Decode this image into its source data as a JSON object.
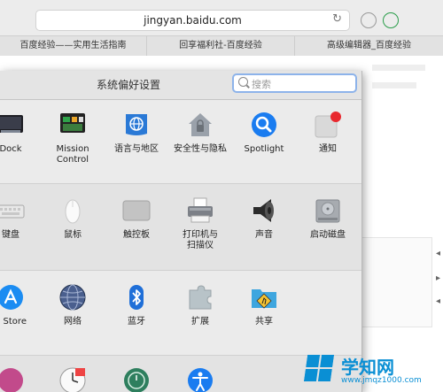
{
  "browser": {
    "url": "jingyan.baidu.com",
    "reload_icon": "reload-icon",
    "tabs": [
      "百度经验——实用生活指南",
      "回享福利社-百度经验",
      "高级编辑器_百度经验"
    ]
  },
  "window": {
    "title": "系统偏好设置",
    "search_placeholder": "搜索"
  },
  "rows": [
    [
      {
        "label": "Dock",
        "icon": "dock-icon"
      },
      {
        "label": "Mission\nControl",
        "icon": "mission-control-icon"
      },
      {
        "label": "语言与地区",
        "icon": "language-region-icon"
      },
      {
        "label": "安全性与隐私",
        "icon": "security-privacy-icon"
      },
      {
        "label": "Spotlight",
        "icon": "spotlight-icon"
      },
      {
        "label": "通知",
        "icon": "notifications-icon"
      }
    ],
    [
      {
        "label": "键盘",
        "icon": "keyboard-icon"
      },
      {
        "label": "鼠标",
        "icon": "mouse-icon"
      },
      {
        "label": "触控板",
        "icon": "trackpad-icon"
      },
      {
        "label": "打印机与\n扫描仪",
        "icon": "printer-scanner-icon"
      },
      {
        "label": "声音",
        "icon": "sound-icon"
      },
      {
        "label": "启动磁盘",
        "icon": "startup-disk-icon"
      }
    ],
    [
      {
        "label": "p Store",
        "icon": "app-store-icon"
      },
      {
        "label": "网络",
        "icon": "network-icon"
      },
      {
        "label": "蓝牙",
        "icon": "bluetooth-icon"
      },
      {
        "label": "扩展",
        "icon": "extensions-icon"
      },
      {
        "label": "共享",
        "icon": "sharing-icon"
      }
    ],
    [
      {
        "label": "",
        "icon": "icloud-icon"
      },
      {
        "label": "",
        "icon": "date-time-icon"
      },
      {
        "label": "",
        "icon": "time-machine-icon"
      },
      {
        "label": "",
        "icon": "accessibility-icon"
      }
    ]
  ],
  "watermark": {
    "text": "学知网",
    "url": "www.jmqz1000.com"
  },
  "colors": {
    "accent": "#1a7cf0",
    "notification_badge": "#e8282e",
    "watermark": "#0a8fd4"
  }
}
